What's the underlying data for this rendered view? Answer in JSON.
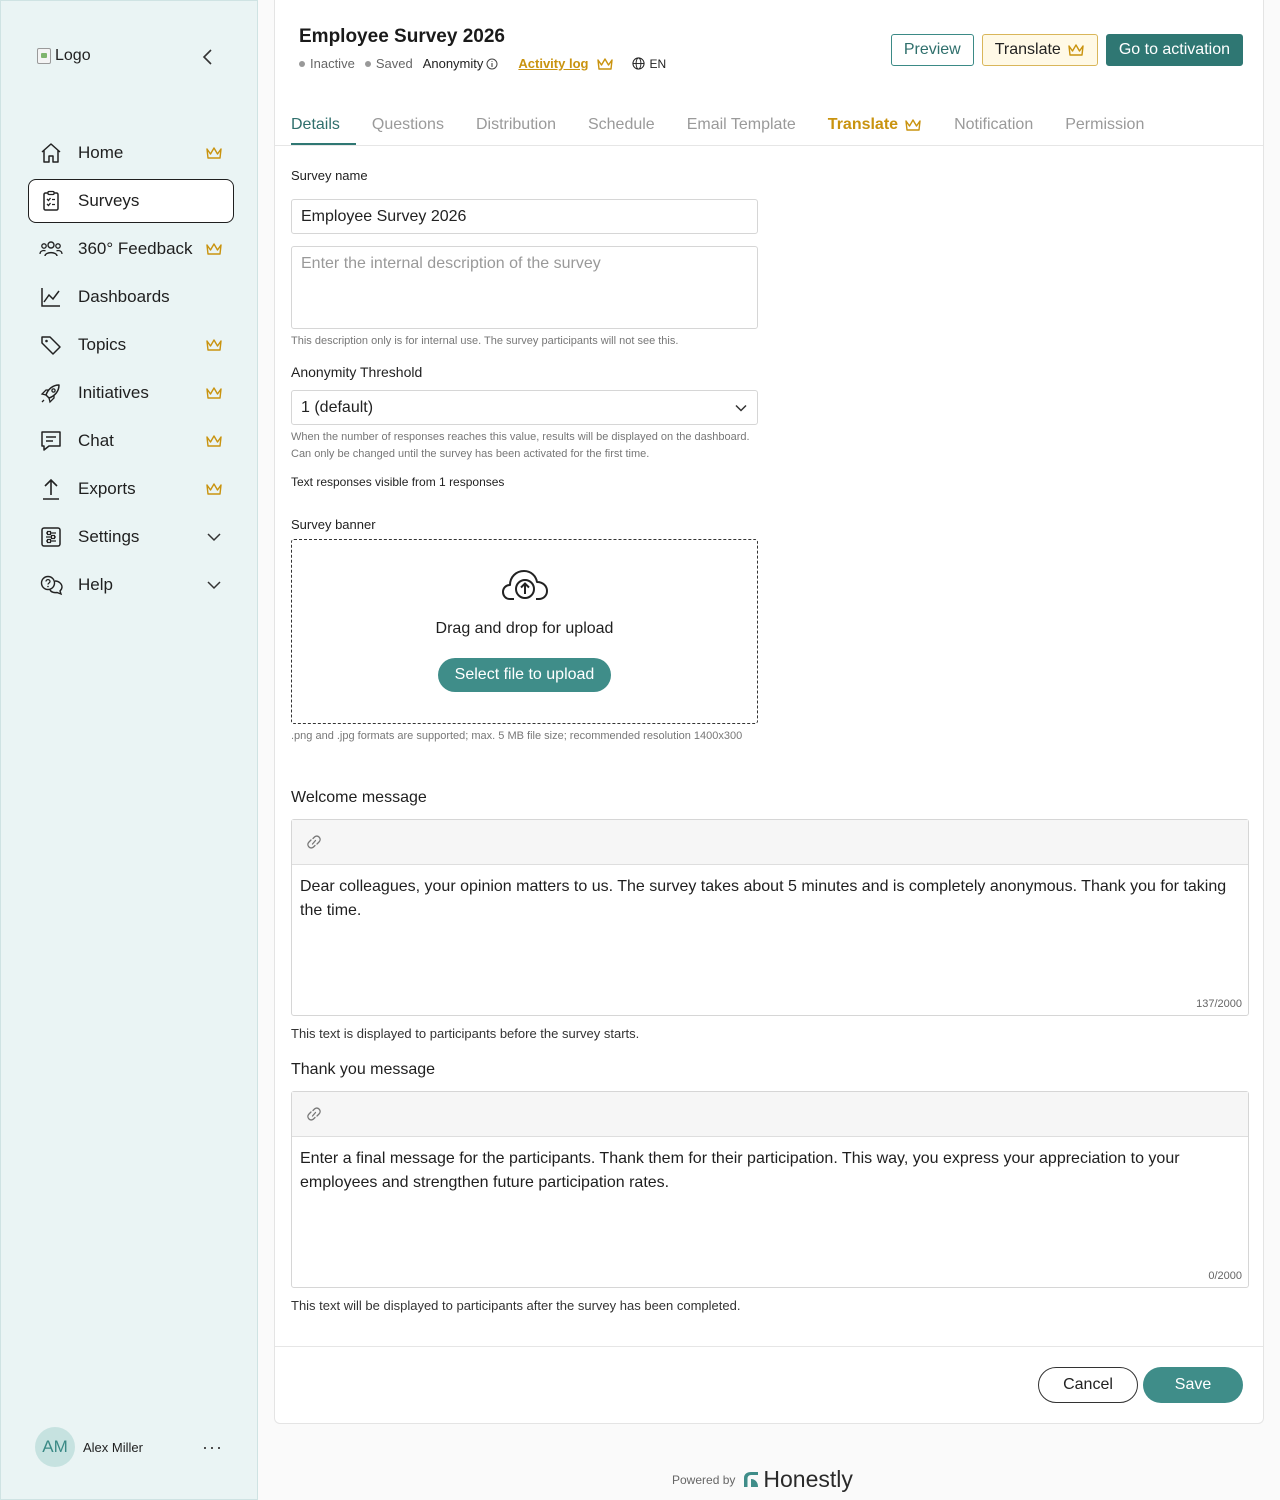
{
  "sidebar": {
    "logo_alt": "Logo",
    "items": [
      {
        "label": "Home",
        "premium": true
      },
      {
        "label": "Surveys",
        "premium": false
      },
      {
        "label": "360° Feedback",
        "premium": true
      },
      {
        "label": "Dashboards",
        "premium": false
      },
      {
        "label": "Topics",
        "premium": true
      },
      {
        "label": "Initiatives",
        "premium": true
      },
      {
        "label": "Chat",
        "premium": true
      },
      {
        "label": "Exports",
        "premium": true
      },
      {
        "label": "Settings",
        "expandable": true
      },
      {
        "label": "Help",
        "expandable": true
      }
    ],
    "user": {
      "initials": "AM",
      "name": "Alex Miller",
      "more": "···"
    }
  },
  "header": {
    "title": "Employee Survey 2026",
    "status": "Inactive",
    "save_state": "Saved",
    "anonymity": "Anonymity",
    "activity_log": "Activity log",
    "language": "EN",
    "preview": "Preview",
    "translate": "Translate",
    "activate": "Go to activation"
  },
  "tabs": [
    "Details",
    "Questions",
    "Distribution",
    "Schedule",
    "Email Template",
    "Translate",
    "Notification",
    "Permission"
  ],
  "form": {
    "survey_name_label": "Survey name",
    "survey_name_value": "Employee Survey 2026",
    "description_placeholder": "Enter the internal description of the survey",
    "description_help": "This description only is for internal use. The survey participants will not see this.",
    "anonymity_label": "Anonymity Threshold",
    "anonymity_value": "1 (default)",
    "anonymity_help": "When the number of responses reaches this value, results will be displayed on the dashboard. Can only be changed until the survey has been activated for the first time.",
    "text_visible": "Text responses visible from 1 responses",
    "banner_label": "Survey banner",
    "banner_drop": "Drag and drop for upload",
    "banner_button": "Select file to upload",
    "banner_help": ".png and .jpg formats are supported; max. 5 MB file size; recommended resolution 1400x300",
    "welcome_label": "Welcome message",
    "welcome_text": "Dear colleagues, your opinion matters to us. The survey takes about 5 minutes and is completely anonymous. Thank you for taking the time.",
    "welcome_count": "137/2000",
    "welcome_note": "This text is displayed to participants before the survey starts.",
    "thanks_label": "Thank you message",
    "thanks_placeholder": "Enter a final message for the participants. Thank them for their participation. This way, you express your appreciation to your employees and strengthen future participation rates.",
    "thanks_count": "0/2000",
    "thanks_note": "This text will be displayed to participants after the survey has been completed."
  },
  "actions": {
    "cancel": "Cancel",
    "save": "Save"
  },
  "footer": {
    "powered_by": "Powered by",
    "brand": "Honestly"
  },
  "colors": {
    "accent": "#2f7773",
    "premium": "#c9930f",
    "sidebar_bg": "#eaf4f4"
  }
}
